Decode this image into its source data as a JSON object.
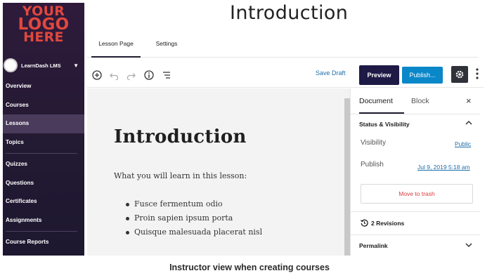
{
  "logo": {
    "line1": "YOUR",
    "line2": "LOGO",
    "line3": "HERE"
  },
  "brand": {
    "name": "LearnDash LMS"
  },
  "nav": {
    "items": [
      "Overview",
      "Courses",
      "Lessons",
      "Topics",
      "Quizzes",
      "Questions",
      "Certificates",
      "Assignments",
      "Course Reports"
    ],
    "active": "Lessons"
  },
  "page": {
    "title": "Introduction"
  },
  "tabs": {
    "lesson_page": "Lesson Page",
    "settings": "Settings"
  },
  "toolbar": {
    "save_draft": "Save Draft",
    "preview": "Preview",
    "publish": "Publish..."
  },
  "editor": {
    "title": "Introduction",
    "intro": "What you will learn in this lesson:",
    "bullets": [
      "Fusce fermentum odio",
      "Proin sapien ipsum porta",
      "Quisque malesuada placerat nisl"
    ]
  },
  "panel": {
    "tab_document": "Document",
    "tab_block": "Block",
    "close": "×",
    "status_title": "Status & Visibility",
    "visibility_label": "Visibility",
    "visibility_value": "Public",
    "publish_label": "Publish",
    "publish_value": "Jul 9, 2019 5:18 am",
    "trash": "Move to trash",
    "revisions": "2 Revisions",
    "permalink": "Permalink"
  },
  "caption": "Instructor view when creating courses",
  "colors": {
    "sidebar_bg": "#2f1a3b",
    "logo_red": "#e0483d",
    "preview_bg": "#1d1a45",
    "publish_bg": "#0a87c9",
    "link_blue": "#1e6fa8",
    "trash_red": "#d64141"
  },
  "icons": [
    "add-block-icon",
    "undo-icon",
    "redo-icon",
    "info-icon",
    "list-view-icon",
    "gear-icon",
    "more-vertical-icon",
    "chevron-up-icon",
    "chevron-down-icon",
    "revisions-icon",
    "close-icon"
  ]
}
